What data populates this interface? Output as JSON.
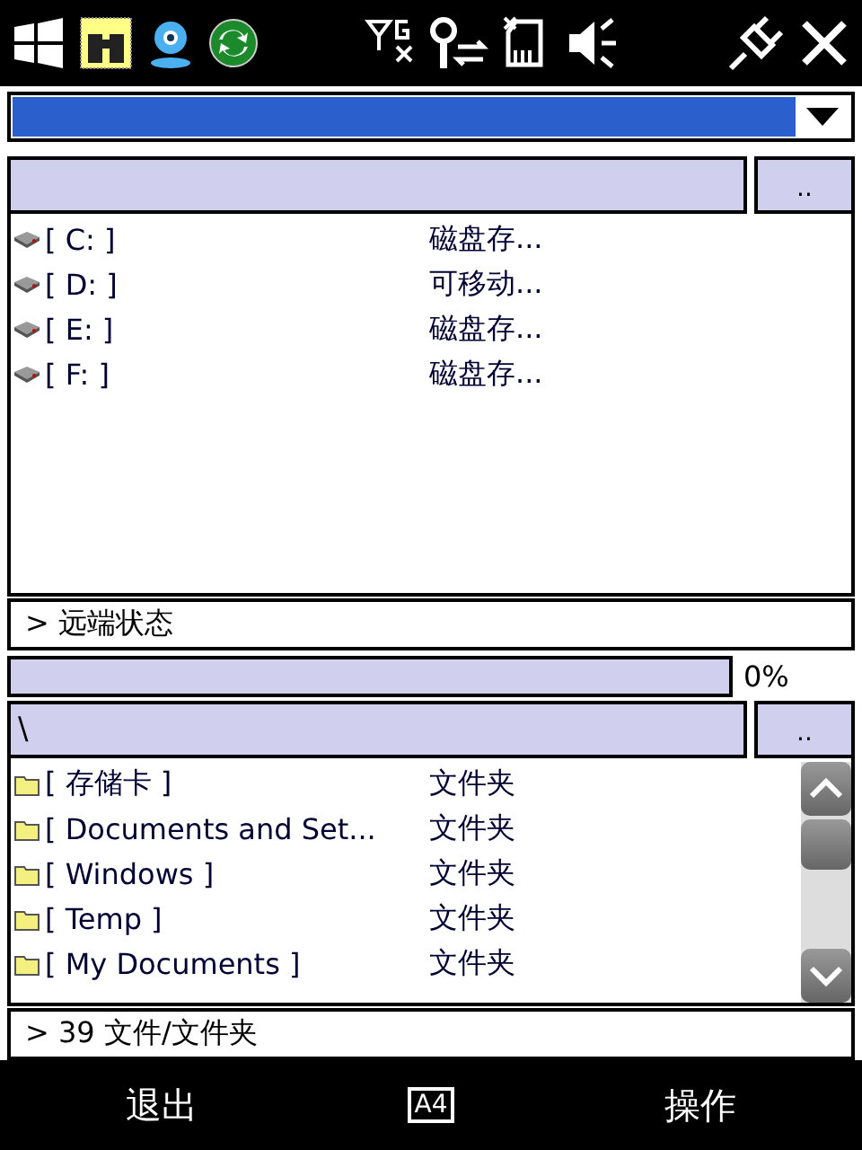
{
  "dropdown": {
    "selected_text_highlighted": true
  },
  "remote_panel": {
    "up_button": "..",
    "rows": [
      {
        "kind": "drive",
        "name": "[ C: ]",
        "type": "磁盘存..."
      },
      {
        "kind": "drive",
        "name": "[ D: ]",
        "type": "可移动..."
      },
      {
        "kind": "drive",
        "name": "[ E: ]",
        "type": "磁盘存..."
      },
      {
        "kind": "drive",
        "name": "[ F: ]",
        "type": "磁盘存..."
      }
    ],
    "status": "> 远端状态"
  },
  "progress": {
    "level": 0,
    "reading": "0%"
  },
  "local_panel": {
    "path": "\\",
    "up_button": "..",
    "rows": [
      {
        "kind": "folder",
        "name": "[ 存储卡 ]",
        "type": "文件夹"
      },
      {
        "kind": "folder",
        "name": "[ Documents and Set...",
        "type": "文件夹"
      },
      {
        "kind": "folder",
        "name": "[ Windows ]",
        "type": "文件夹"
      },
      {
        "kind": "folder",
        "name": "[ Temp ]",
        "type": "文件夹"
      },
      {
        "kind": "folder",
        "name": "[ My Documents ]",
        "type": "文件夹"
      }
    ],
    "status": "> 39 文件/文件夹"
  },
  "softkeys": {
    "left": "退出",
    "input_indicator": "A4",
    "right": "操作"
  }
}
